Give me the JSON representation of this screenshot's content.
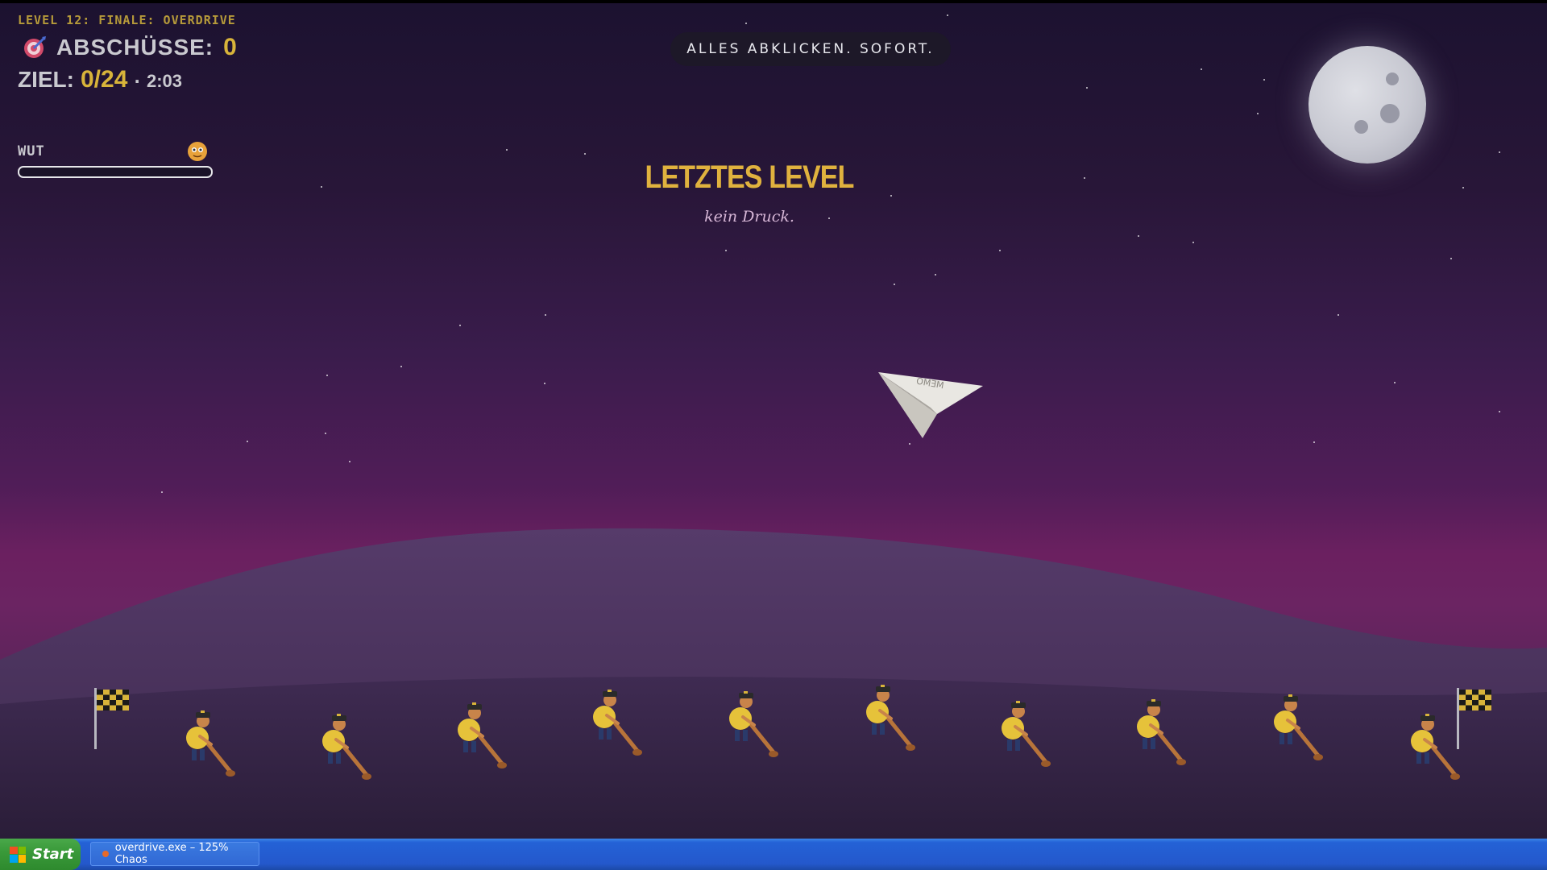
{
  "hud": {
    "level": "LEVEL 12: FINALE: OVERDRIVE",
    "kills_label": "ABSCHÜSSE:",
    "kills_value": "0",
    "goal_label": "ZIEL:",
    "goal_value": "0/24",
    "goal_separator": "·",
    "time": "2:03",
    "rage_label": "WUT",
    "rage_level": 0
  },
  "banner": "ALLES ABKLICKEN. SOFORT.",
  "title": "LETZTES LEVEL",
  "subtitle": "kein Druck.",
  "plane_label": "MEMO",
  "taskbar": {
    "start_label": "Start",
    "window_title": "overdrive.exe – 125% Chaos"
  },
  "colors": {
    "accent_gold": "#d8b43a",
    "sky_top": "#1c1230",
    "horizon": "#6b2060",
    "ground": "#3a2548",
    "taskbar": "#2458cc"
  },
  "icons": [
    "target-icon",
    "rage-face-icon",
    "paper-plane-icon",
    "checkered-flag-icon",
    "windows-logo-icon"
  ]
}
